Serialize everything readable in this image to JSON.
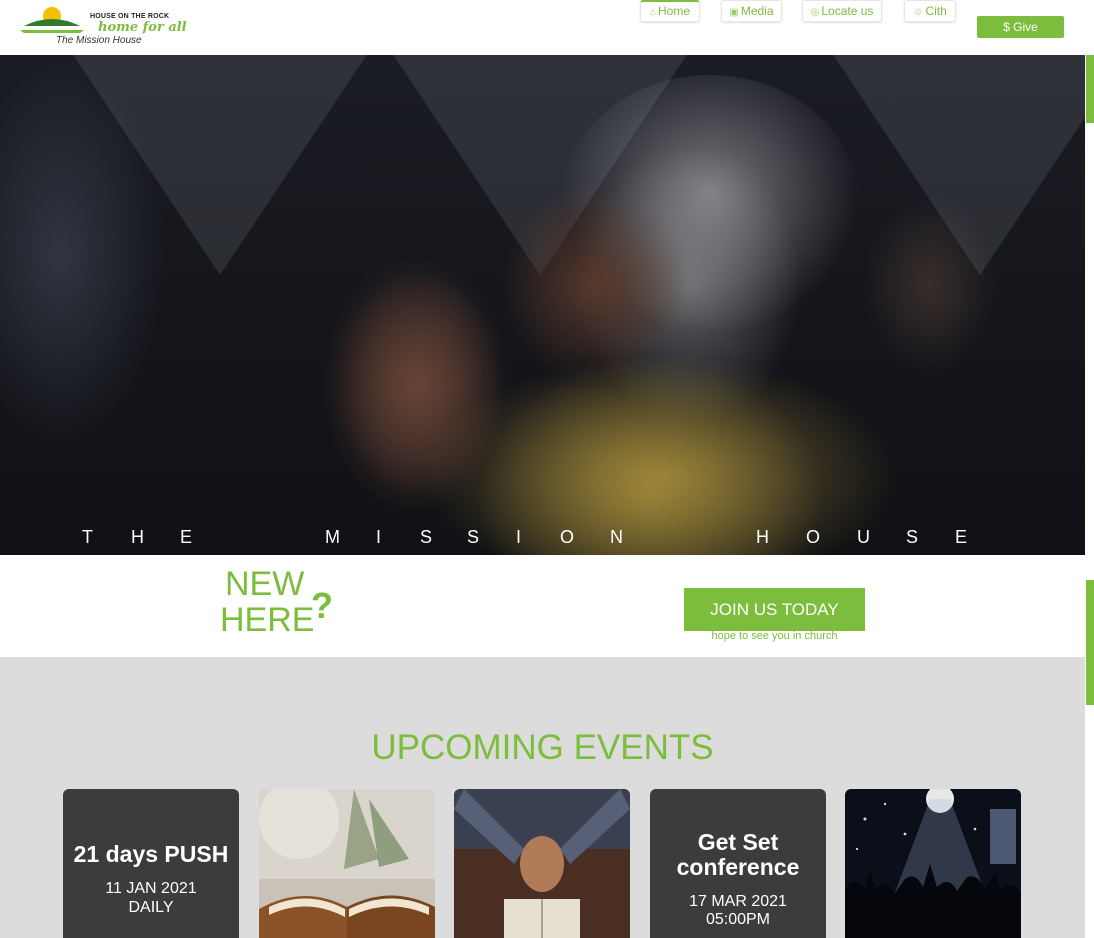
{
  "brand": {
    "name": "HOUSE ON THE ROCK",
    "tagline": "home for all",
    "subtitle": "The Mission House"
  },
  "nav": {
    "items": [
      {
        "label": "Home",
        "icon": "home-icon"
      },
      {
        "label": "Media",
        "icon": "media-icon"
      },
      {
        "label": "Locate us",
        "icon": "location-pin-icon"
      },
      {
        "label": "Cith",
        "icon": "people-icon"
      }
    ],
    "give_label": "$ Give"
  },
  "hero": {
    "caption_word_1": "THE",
    "caption_word_2": "MISSION",
    "caption_word_3": "HOUSE"
  },
  "new_here": {
    "line1": "NEW",
    "line2": "HERE",
    "mark": "?",
    "button_label": "JOIN US TODAY",
    "button_sub": "hope to see you in church"
  },
  "events": {
    "title": "UPCOMING EVENTS",
    "cards": [
      {
        "title": "21 days PUSH",
        "date_line1": "11 JAN 2021",
        "date_line2": "DAILY"
      },
      {
        "title": "",
        "image": "open-bible-photo"
      },
      {
        "title": "",
        "image": "praying-hands-photo"
      },
      {
        "title": "Get Set conference",
        "title_line1": "Get Set",
        "title_line2": "conference",
        "date_line1": "17 MAR 2021",
        "date_line2": "05:00PM"
      },
      {
        "title": "",
        "image": "worship-crowd-photo"
      }
    ]
  },
  "colors": {
    "accent": "#7cbd3e",
    "card_dark": "#3c3c3c",
    "section_bg": "#dcdcdc"
  }
}
